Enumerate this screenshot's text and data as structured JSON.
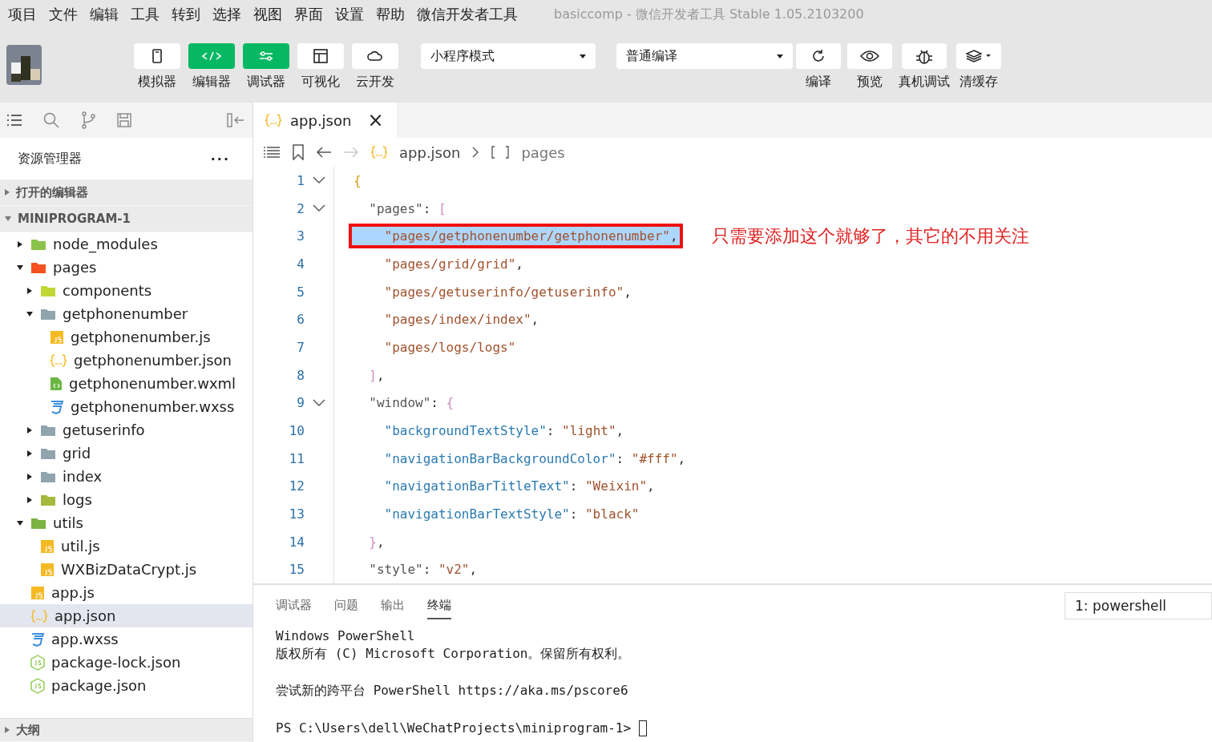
{
  "menu": [
    "项目",
    "文件",
    "编辑",
    "工具",
    "转到",
    "选择",
    "视图",
    "界面",
    "设置",
    "帮助",
    "微信开发者工具"
  ],
  "window": {
    "title": "basiccomp - 微信开发者工具 Stable 1.05.2103200"
  },
  "toolbar": {
    "views": [
      {
        "label": "模拟器",
        "kind": "phone",
        "selected": false
      },
      {
        "label": "编辑器",
        "kind": "code",
        "selected": true
      },
      {
        "label": "调试器",
        "kind": "sliders",
        "selected": true
      },
      {
        "label": "可视化",
        "kind": "layout",
        "selected": false
      },
      {
        "label": "云开发",
        "kind": "cloud",
        "selected": false
      }
    ],
    "mode": "小程序模式",
    "compile_mode": "普通编译",
    "actions": [
      {
        "label": "编译",
        "kind": "refresh"
      },
      {
        "label": "预览",
        "kind": "eye"
      },
      {
        "label": "真机调试",
        "kind": "bug"
      },
      {
        "label": "清缓存",
        "kind": "layers"
      }
    ]
  },
  "sidebar": {
    "title": "资源管理器",
    "more": "···",
    "sections": [
      {
        "label": "打开的编辑器",
        "expanded": false
      },
      {
        "label": "MINIPROGRAM-1",
        "expanded": true
      }
    ],
    "tree": [
      {
        "name": "node_modules",
        "kind": "folder",
        "color": "#8bc34a",
        "expanded": false,
        "selected": false
      },
      {
        "name": "pages",
        "kind": "folder",
        "color": "#f4511e",
        "expanded": true,
        "selected": false,
        "children": [
          {
            "name": "components",
            "kind": "folder",
            "color": "#c0d836",
            "expanded": false,
            "selected": false
          },
          {
            "name": "getphonenumber",
            "kind": "folder",
            "color": "#90a4ae",
            "expanded": true,
            "selected": false,
            "children": [
              {
                "name": "getphonenumber.js",
                "kind": "js",
                "selected": false
              },
              {
                "name": "getphonenumber.json",
                "kind": "json",
                "selected": false
              },
              {
                "name": "getphonenumber.wxml",
                "kind": "wxml",
                "selected": false
              },
              {
                "name": "getphonenumber.wxss",
                "kind": "wxss",
                "selected": false
              }
            ]
          },
          {
            "name": "getuserinfo",
            "kind": "folder",
            "color": "#90a4ae",
            "expanded": false,
            "selected": false
          },
          {
            "name": "grid",
            "kind": "folder",
            "color": "#90a4ae",
            "expanded": false,
            "selected": false
          },
          {
            "name": "index",
            "kind": "folder",
            "color": "#90a4ae",
            "expanded": false,
            "selected": false
          },
          {
            "name": "logs",
            "kind": "folder",
            "color": "#a4b93c",
            "expanded": false,
            "selected": false
          }
        ]
      },
      {
        "name": "utils",
        "kind": "folder",
        "color": "#7cb342",
        "expanded": true,
        "selected": false,
        "children": [
          {
            "name": "util.js",
            "kind": "js",
            "selected": false
          },
          {
            "name": "WXBizDataCrypt.js",
            "kind": "js",
            "selected": false
          }
        ]
      },
      {
        "name": "app.js",
        "kind": "js",
        "selected": false
      },
      {
        "name": "app.json",
        "kind": "json",
        "selected": true
      },
      {
        "name": "app.wxss",
        "kind": "wxss",
        "selected": false
      },
      {
        "name": "package-lock.json",
        "kind": "node",
        "selected": false
      },
      {
        "name": "package.json",
        "kind": "node",
        "selected": false
      }
    ],
    "outline": {
      "label": "大纲",
      "expanded": false
    }
  },
  "editor": {
    "tab": {
      "name": "app.json",
      "close": "×"
    },
    "breadcrumb": [
      {
        "kind": "file",
        "text": "app.json"
      },
      {
        "kind": "array",
        "text": "pages"
      }
    ],
    "lines": [
      {
        "number": "1",
        "fold": true,
        "selected": false,
        "boxed": false,
        "tokens": [
          {
            "kind": "brace",
            "text": "{"
          }
        ]
      },
      {
        "number": "2",
        "fold": true,
        "selected": false,
        "boxed": false,
        "tokens": [
          {
            "kind": "key",
            "text": "  \"pages\""
          },
          {
            "kind": "punct",
            "text": ": "
          },
          {
            "kind": "bracket",
            "text": "["
          }
        ]
      },
      {
        "number": "3",
        "fold": false,
        "selected": true,
        "boxed": true,
        "tokens": [
          {
            "kind": "string",
            "text": "    \"pages/getphonenumber/getphonenumber\""
          },
          {
            "kind": "punct",
            "text": ","
          }
        ]
      },
      {
        "number": "4",
        "fold": false,
        "selected": false,
        "boxed": false,
        "tokens": [
          {
            "kind": "string",
            "text": "    \"pages/grid/grid\""
          },
          {
            "kind": "punct",
            "text": ","
          }
        ]
      },
      {
        "number": "5",
        "fold": false,
        "selected": false,
        "boxed": false,
        "tokens": [
          {
            "kind": "string",
            "text": "    \"pages/getuserinfo/getuserinfo\""
          },
          {
            "kind": "punct",
            "text": ","
          }
        ]
      },
      {
        "number": "6",
        "fold": false,
        "selected": false,
        "boxed": false,
        "tokens": [
          {
            "kind": "string",
            "text": "    \"pages/index/index\""
          },
          {
            "kind": "punct",
            "text": ","
          }
        ]
      },
      {
        "number": "7",
        "fold": false,
        "selected": false,
        "boxed": false,
        "tokens": [
          {
            "kind": "string",
            "text": "    \"pages/logs/logs\""
          }
        ]
      },
      {
        "number": "8",
        "fold": false,
        "selected": false,
        "boxed": false,
        "tokens": [
          {
            "kind": "bracket",
            "text": "  ]"
          },
          {
            "kind": "punct",
            "text": ","
          }
        ]
      },
      {
        "number": "9",
        "fold": true,
        "selected": false,
        "boxed": false,
        "tokens": [
          {
            "kind": "key",
            "text": "  \"window\""
          },
          {
            "kind": "punct",
            "text": ": "
          },
          {
            "kind": "bracket",
            "text": "{"
          }
        ]
      },
      {
        "number": "10",
        "fold": false,
        "selected": false,
        "boxed": false,
        "tokens": [
          {
            "kind": "prop",
            "text": "    \"backgroundTextStyle\""
          },
          {
            "kind": "punct",
            "text": ": "
          },
          {
            "kind": "string",
            "text": "\"light\""
          },
          {
            "kind": "punct",
            "text": ","
          }
        ]
      },
      {
        "number": "11",
        "fold": false,
        "selected": false,
        "boxed": false,
        "tokens": [
          {
            "kind": "prop",
            "text": "    \"navigationBarBackgroundColor\""
          },
          {
            "kind": "punct",
            "text": ": "
          },
          {
            "kind": "string",
            "text": "\"#fff\""
          },
          {
            "kind": "punct",
            "text": ","
          }
        ]
      },
      {
        "number": "12",
        "fold": false,
        "selected": false,
        "boxed": false,
        "tokens": [
          {
            "kind": "prop",
            "text": "    \"navigationBarTitleText\""
          },
          {
            "kind": "punct",
            "text": ": "
          },
          {
            "kind": "string",
            "text": "\"Weixin\""
          },
          {
            "kind": "punct",
            "text": ","
          }
        ]
      },
      {
        "number": "13",
        "fold": false,
        "selected": false,
        "boxed": false,
        "tokens": [
          {
            "kind": "prop",
            "text": "    \"navigationBarTextStyle\""
          },
          {
            "kind": "punct",
            "text": ": "
          },
          {
            "kind": "string",
            "text": "\"black\""
          }
        ]
      },
      {
        "number": "14",
        "fold": false,
        "selected": false,
        "boxed": false,
        "tokens": [
          {
            "kind": "bracket",
            "text": "  }"
          },
          {
            "kind": "punct",
            "text": ","
          }
        ]
      },
      {
        "number": "15",
        "fold": false,
        "selected": false,
        "boxed": false,
        "tokens": [
          {
            "kind": "key",
            "text": "  \"style\""
          },
          {
            "kind": "punct",
            "text": ": "
          },
          {
            "kind": "string",
            "text": "\"v2\""
          },
          {
            "kind": "punct",
            "text": ","
          }
        ]
      }
    ],
    "annotation": "只需要添加这个就够了，其它的不用关注"
  },
  "panel": {
    "tabs": [
      {
        "label": "调试器",
        "selected": false
      },
      {
        "label": "问题",
        "selected": false
      },
      {
        "label": "输出",
        "selected": false
      },
      {
        "label": "终端",
        "selected": true
      }
    ],
    "terminal_select": "1: powershell",
    "output": [
      [
        "Windows PowerShell",
        "版权所有 (C) Microsoft Corporation。保留所有权利。"
      ],
      [
        "尝试新的跨平台 PowerShell https://aka.ms/pscore6"
      ]
    ],
    "prompt": "PS C:\\Users\\dell\\WeChatProjects\\miniprogram-1>"
  }
}
